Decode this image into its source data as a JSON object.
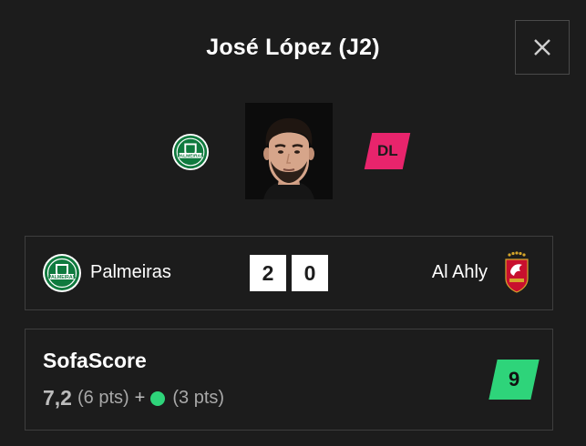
{
  "player": {
    "name": "José López (J2)",
    "position": "DL",
    "position_color": "#e8246c"
  },
  "icons": {
    "close": "close-icon",
    "team_logo": "palmeiras-crest-icon",
    "away_logo": "al-ahly-crest-icon"
  },
  "match": {
    "home_team": "Palmeiras",
    "away_team": "Al Ahly",
    "home_score": "2",
    "away_score": "0"
  },
  "rating": {
    "title": "SofaScore",
    "value": "7,2",
    "base_pts": "(6 pts)",
    "plus": "+",
    "bonus_pts": "(3 pts)",
    "bonus_color": "#2ed47a",
    "badge": "9",
    "badge_color": "#2ed47a"
  }
}
